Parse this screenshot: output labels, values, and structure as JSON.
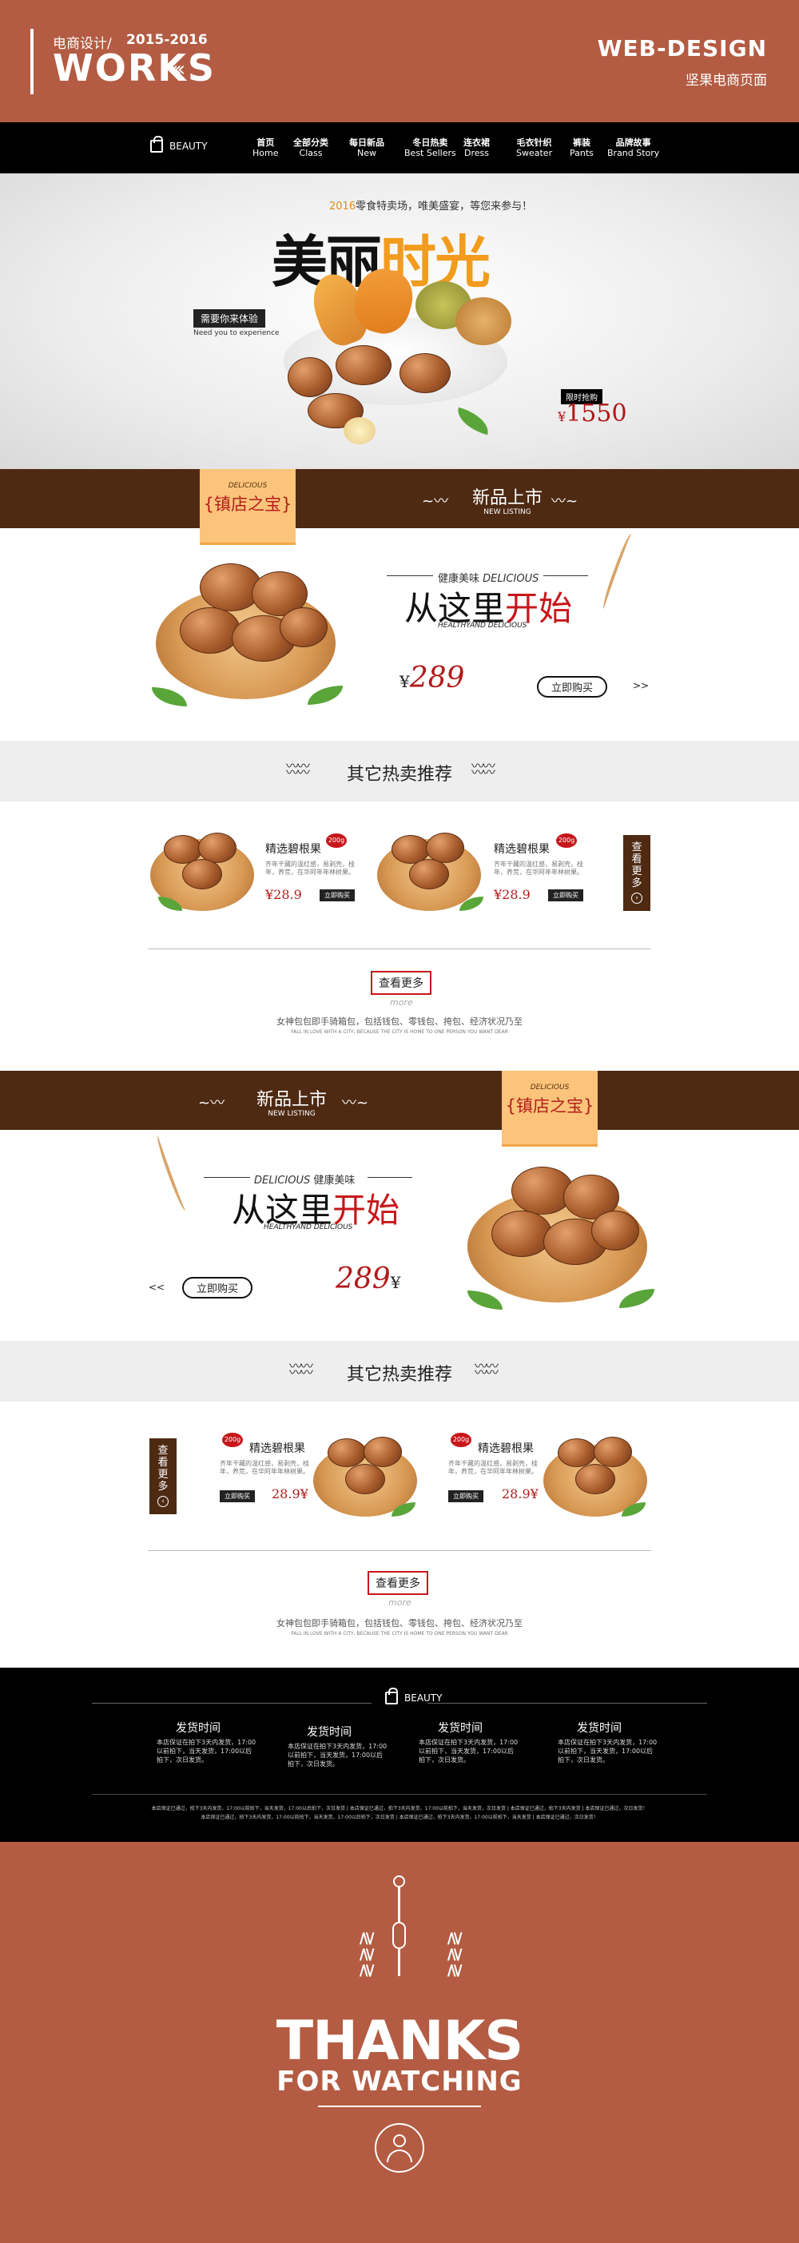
{
  "header": {
    "subtitle": "电商设计/",
    "years": "2015-2016",
    "works": "WORKS",
    "chevrons": "‹‹‹",
    "web_design": "WEB-DESIGN",
    "web_design_sub": "坚果电商页面"
  },
  "nav": {
    "brand": "BEAUTY",
    "items": [
      {
        "cn": "首页",
        "en": "Home"
      },
      {
        "cn": "全部分类",
        "en": "Class"
      },
      {
        "cn": "每日新品",
        "en": "New"
      },
      {
        "cn": "冬日热卖",
        "en": "Best Sellers"
      },
      {
        "cn": "连衣裙",
        "en": "Dress"
      },
      {
        "cn": "毛衣针织",
        "en": "Sweater"
      },
      {
        "cn": "裤装",
        "en": "Pants"
      },
      {
        "cn": "品牌故事",
        "en": "Brand Story"
      }
    ]
  },
  "hero": {
    "tagline_year": "2016",
    "tagline": "零食特卖场，唯美盛宴，等您来参与！",
    "title_a": "美丽",
    "title_b": "时光",
    "pill": "需要你来体验",
    "pill_sub": "Need you to experience",
    "limited": "限时抢购",
    "price_symbol": "¥",
    "price": "1550"
  },
  "section1": {
    "badge_en": "DELICIOUS",
    "badge_cn": "{镇店之宝}",
    "new_cn": "新品上市",
    "new_en": "NEW LISTING",
    "healthy_cn": "健康美味",
    "healthy_en": "DELICIOUS",
    "big_a": "从这里",
    "big_b": "开始",
    "big_sub": "HEALTHYAND DELICIOUS",
    "price_symbol": "¥",
    "price": "289",
    "buy": "立即购买",
    "arrow": ">>"
  },
  "hot1": {
    "title": "其它热卖推荐",
    "cards": [
      {
        "name": "精选碧根果",
        "tag": "200g",
        "desc": "齐年干藏的温红感，易剥壳，桂年，养荒，在华阿年年林树果。",
        "price": "¥28.9",
        "btn": "立即购买"
      },
      {
        "name": "精选碧根果",
        "tag": "200g",
        "desc": "齐年干藏的温红感，易剥壳，桂年，养荒，在华阿年年林树果。",
        "price": "¥28.9",
        "btn": "立即购买"
      }
    ],
    "side": [
      "查",
      "看",
      "更",
      "多"
    ],
    "side_arrow": "›",
    "more": "查看更多",
    "more_en": "more",
    "slogan": "女神包包即手骑箱包，包括钱包、零钱包、挎包、经济状况乃至",
    "slogan_en": "FALL IN LOVE WITH A CITY, BECAUSE THE CITY IS HOME TO ONE PERSON YOU WANT DEAR"
  },
  "section2": {
    "badge_en": "DELICIOUS",
    "badge_cn": "{镇店之宝}",
    "new_cn": "新品上市",
    "new_en": "NEW LISTING",
    "healthy_cn": "健康美味",
    "healthy_en": "DELICIOUS",
    "big_a": "从这里",
    "big_b": "开始",
    "big_sub": "HEALTHYAND DELICIOUS",
    "price": "289",
    "price_symbol": "¥",
    "buy": "立即购买",
    "arrow": "<<"
  },
  "hot2": {
    "title": "其它热卖推荐",
    "cards": [
      {
        "name": "精选碧根果",
        "tag": "200g",
        "desc": "齐年干藏的温红感，易剥壳，桂年，养荒，在华阿年年林树果。",
        "price": "28.9",
        "sym": "¥",
        "btn": "立即购买"
      },
      {
        "name": "精选碧根果",
        "tag": "200g",
        "desc": "齐年干藏的温红感，易剥壳，桂年，养荒，在华阿年年林树果。",
        "price": "28.9",
        "sym": "¥",
        "btn": "立即购买"
      }
    ],
    "side": [
      "查",
      "看",
      "更",
      "多"
    ],
    "side_arrow": "‹",
    "more": "查看更多",
    "more_en": "more",
    "slogan": "女神包包即手骑箱包，包括钱包、零钱包、挎包、经济状况乃至",
    "slogan_en": "FALL IN LOVE WITH A CITY, BECAUSE THE CITY IS HOME TO ONE PERSON YOU WANT DEAR"
  },
  "footer": {
    "brand": "BEAUTY",
    "cols": [
      {
        "h": "发货时间",
        "d": "本店保证在拍下3天内发货，17:00以前拍下，当天发货，17:00以后拍下，次日发货。"
      },
      {
        "h": "发货时间",
        "d": "本店保证在拍下3天内发货，17:00以前拍下，当天发货，17:00以后拍下，次日发货。"
      },
      {
        "h": "发货时间",
        "d": "本店保证在拍下3天内发货，17:00以前拍下，当天发货，17:00以后拍下，次日发货。"
      },
      {
        "h": "发货时间",
        "d": "本店保证在拍下3天内发货，17:00以前拍下，当天发货，17:00以后拍下，次日发货。"
      }
    ],
    "legal1": "本店保证已通过，拍下3天内发货，17:00以前拍下，当天发货，17:00以后拍下，次日发货 | 本店保证已通过，拍下3天内发货，17:00以前拍下，当天发货，次日发货 | 本店保证已通过，拍下3天内发货 | 本店保证已通过，次日发货！",
    "legal2": "本店保证已通过，拍下3天内发货，17:00以前拍下，当天发货，17:00以后拍下，次日发货 | 本店保证已通过，拍下3天内发货，17:00以前拍下，当天发货 | 本店保证已通过，次日发货！"
  },
  "thanks": {
    "line1": "THANKS",
    "line2": "FOR WATCHING",
    "waves": "≷≷≷"
  },
  "colors": {
    "terracotta": "#b35c43",
    "brown": "#4e2a13",
    "accent_red": "#c7171b",
    "orange": "#f29b1d",
    "badge": "#fbc47a"
  }
}
